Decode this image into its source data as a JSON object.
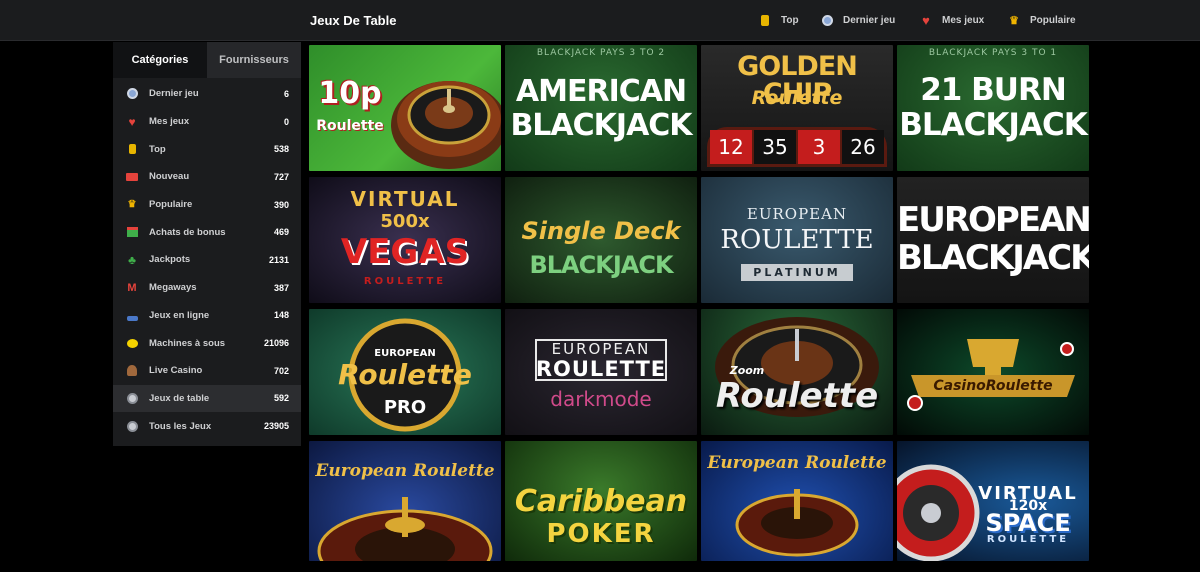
{
  "header": {
    "title": "Jeux De Table",
    "nav": [
      {
        "label": "Top",
        "icon": "gold-coin-icon"
      },
      {
        "label": "Dernier jeu",
        "icon": "clock-icon"
      },
      {
        "label": "Mes jeux",
        "icon": "heart-icon"
      },
      {
        "label": "Populaire",
        "icon": "crown-icon"
      }
    ]
  },
  "sidebar": {
    "tabs": [
      "Catégories",
      "Fournisseurs"
    ],
    "active_tab": 0,
    "items": [
      {
        "label": "Dernier jeu",
        "count": "6",
        "icon": "clock-icon"
      },
      {
        "label": "Mes jeux",
        "count": "0",
        "icon": "heart-icon"
      },
      {
        "label": "Top",
        "count": "538",
        "icon": "gold-coin-icon"
      },
      {
        "label": "Nouveau",
        "count": "727",
        "icon": "new-badge-icon"
      },
      {
        "label": "Populaire",
        "count": "390",
        "icon": "crown-icon"
      },
      {
        "label": "Achats de bonus",
        "count": "469",
        "icon": "gift-icon"
      },
      {
        "label": "Jackpots",
        "count": "2131",
        "icon": "clover-icon"
      },
      {
        "label": "Megaways",
        "count": "387",
        "icon": "megaways-icon"
      },
      {
        "label": "Jeux en ligne",
        "count": "148",
        "icon": "joystick-icon"
      },
      {
        "label": "Machines à sous",
        "count": "21096",
        "icon": "lemon-icon"
      },
      {
        "label": "Live Casino",
        "count": "702",
        "icon": "dealer-icon"
      },
      {
        "label": "Jeux de table",
        "count": "592",
        "icon": "roulette-icon"
      },
      {
        "label": "Tous les Jeux",
        "count": "23905",
        "icon": "all-games-icon"
      }
    ],
    "active_item": 11
  },
  "games": [
    {
      "line1": "10p",
      "line2": "Roulette"
    },
    {
      "top": "BLACKJACK PAYS 3 TO 2",
      "line1": "AMERICAN",
      "line2": "BLACKJACK"
    },
    {
      "line1": "GOLDEN CHIP",
      "line2": "Roulette",
      "numbers": [
        "12",
        "35",
        "3",
        "26"
      ]
    },
    {
      "top": "BLACKJACK PAYS 3 TO 1",
      "line1": "21 BURN",
      "line2": "BLACKJACK"
    },
    {
      "line1": "VIRTUAL",
      "line2": "500x",
      "line3": "VEGAS",
      "line4": "ROULETTE"
    },
    {
      "line1": "Single Deck",
      "line2": "BLACKJACK"
    },
    {
      "line1": "EUROPEAN",
      "line2": "ROULETTE",
      "line3": "PLATINUM"
    },
    {
      "line1": "EUROPEAN",
      "line2": "BLACKJACK"
    },
    {
      "line1": "EUROPEAN",
      "line2": "Roulette",
      "line3": "PRO"
    },
    {
      "line1": "EUROPEAN",
      "line2": "ROULETTE",
      "line3": "darkmode"
    },
    {
      "line1": "Zoom",
      "line2": "Roulette"
    },
    {
      "line1": "CasinoRoulette"
    },
    {
      "line1": "European Roulette"
    },
    {
      "line1": "Caribbean",
      "line2": "POKER"
    },
    {
      "line1": "European Roulette"
    },
    {
      "line1": "VIRTUAL",
      "line2": "120x",
      "line3": "SPACE",
      "line4": "ROULETTE"
    }
  ]
}
